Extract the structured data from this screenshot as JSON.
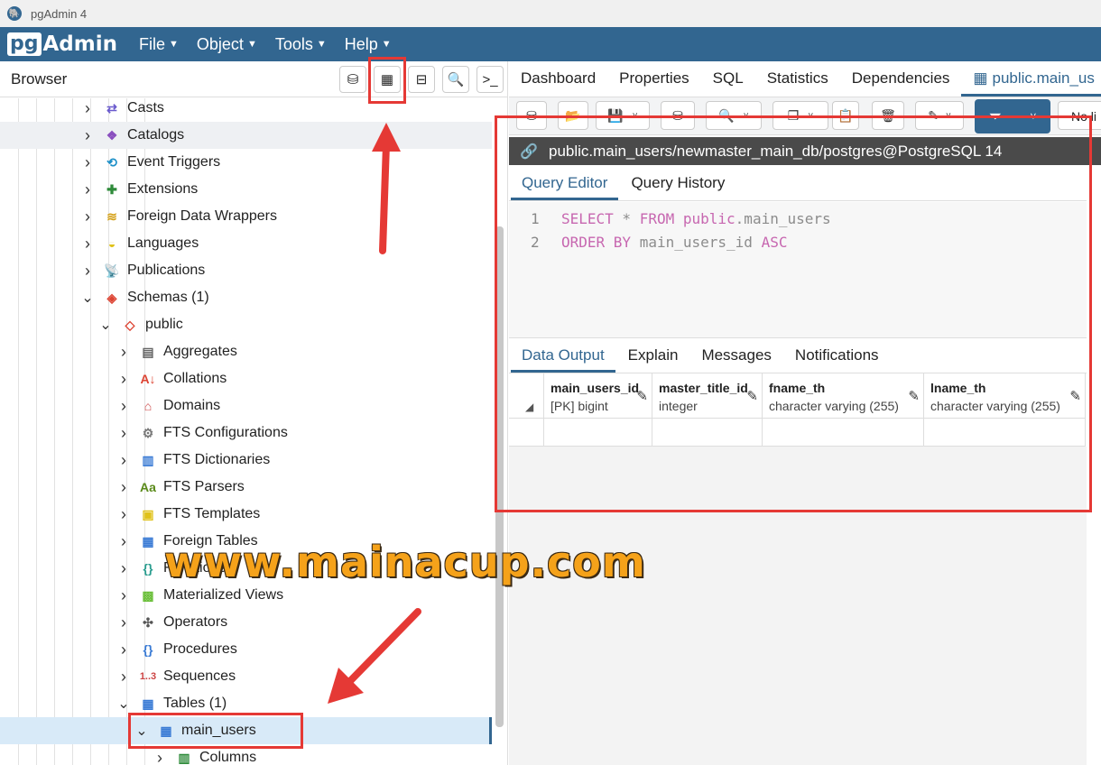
{
  "window": {
    "title": "pgAdmin 4"
  },
  "menubar": {
    "logo_pg": "pg",
    "logo_admin": "Admin",
    "items": [
      "File",
      "Object",
      "Tools",
      "Help"
    ]
  },
  "browser": {
    "title": "Browser"
  },
  "tree": [
    {
      "label": "Casts",
      "icon": "casts-icon",
      "level": 0,
      "expanded": false
    },
    {
      "label": "Catalogs",
      "icon": "catalogs-icon",
      "level": 0,
      "expanded": false,
      "highlight": true
    },
    {
      "label": "Event Triggers",
      "icon": "event-triggers-icon",
      "level": 0,
      "expanded": false
    },
    {
      "label": "Extensions",
      "icon": "extensions-icon",
      "level": 0,
      "expanded": false
    },
    {
      "label": "Foreign Data Wrappers",
      "icon": "foreign-data-wrappers-icon",
      "level": 0,
      "expanded": false
    },
    {
      "label": "Languages",
      "icon": "languages-icon",
      "level": 0,
      "expanded": false
    },
    {
      "label": "Publications",
      "icon": "publications-icon",
      "level": 0,
      "expanded": false
    },
    {
      "label": "Schemas (1)",
      "icon": "schemas-icon",
      "level": 0,
      "expanded": true
    },
    {
      "label": "public",
      "icon": "schema-icon",
      "level": 1,
      "expanded": true
    },
    {
      "label": "Aggregates",
      "icon": "aggregates-icon",
      "level": 2,
      "expanded": false
    },
    {
      "label": "Collations",
      "icon": "collations-icon",
      "level": 2,
      "expanded": false
    },
    {
      "label": "Domains",
      "icon": "domains-icon",
      "level": 2,
      "expanded": false
    },
    {
      "label": "FTS Configurations",
      "icon": "fts-configurations-icon",
      "level": 2,
      "expanded": false
    },
    {
      "label": "FTS Dictionaries",
      "icon": "fts-dictionaries-icon",
      "level": 2,
      "expanded": false
    },
    {
      "label": "FTS Parsers",
      "icon": "fts-parsers-icon",
      "level": 2,
      "expanded": false
    },
    {
      "label": "FTS Templates",
      "icon": "fts-templates-icon",
      "level": 2,
      "expanded": false
    },
    {
      "label": "Foreign Tables",
      "icon": "foreign-tables-icon",
      "level": 2,
      "expanded": false
    },
    {
      "label": "Functions",
      "icon": "functions-icon",
      "level": 2,
      "expanded": false
    },
    {
      "label": "Materialized Views",
      "icon": "materialized-views-icon",
      "level": 2,
      "expanded": false
    },
    {
      "label": "Operators",
      "icon": "operators-icon",
      "level": 2,
      "expanded": false
    },
    {
      "label": "Procedures",
      "icon": "procedures-icon",
      "level": 2,
      "expanded": false
    },
    {
      "label": "Sequences",
      "icon": "sequences-icon",
      "level": 2,
      "expanded": false
    },
    {
      "label": "Tables (1)",
      "icon": "tables-icon",
      "level": 2,
      "expanded": true
    },
    {
      "label": "main_users",
      "icon": "table-icon",
      "level": 3,
      "expanded": true,
      "selected": true
    },
    {
      "label": "Columns",
      "icon": "columns-icon",
      "level": 4,
      "expanded": false
    }
  ],
  "tabs": [
    "Dashboard",
    "Properties",
    "SQL",
    "Statistics",
    "Dependencies",
    "public.main_us"
  ],
  "toolbar": {
    "limit_label": "No li"
  },
  "connection": {
    "text": "public.main_users/newmaster_main_db/postgres@PostgreSQL 14"
  },
  "query_tabs": [
    "Query Editor",
    "Query History"
  ],
  "editor": {
    "line_numbers": [
      "1",
      "2"
    ],
    "line1": [
      {
        "t": "SELECT",
        "c": "kw"
      },
      {
        "t": " * ",
        "c": "id"
      },
      {
        "t": "FROM",
        "c": "kw"
      },
      {
        "t": " ",
        "c": "id"
      },
      {
        "t": "public",
        "c": "kw"
      },
      {
        "t": ".main_users",
        "c": "id"
      }
    ],
    "line2": [
      {
        "t": "ORDER BY",
        "c": "kw"
      },
      {
        "t": " main_users_id ",
        "c": "id"
      },
      {
        "t": "ASC",
        "c": "kw"
      }
    ]
  },
  "output_tabs": [
    "Data Output",
    "Explain",
    "Messages",
    "Notifications"
  ],
  "grid": {
    "columns": [
      {
        "name": "main_users_id",
        "type": "[PK] bigint"
      },
      {
        "name": "master_title_id",
        "type": "integer"
      },
      {
        "name": "fname_th",
        "type": "character varying (255)"
      },
      {
        "name": "lname_th",
        "type": "character varying (255)"
      }
    ]
  },
  "watermark": "www.mainacup.com",
  "colors": {
    "brand": "#326690",
    "annotation": "#e53935",
    "watermark": "#f5a21a"
  }
}
